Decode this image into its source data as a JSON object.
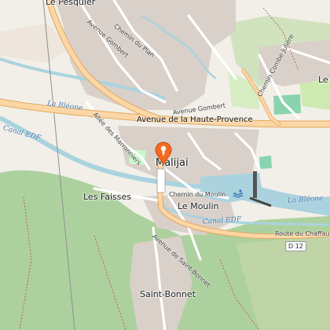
{
  "map": {
    "labels": {
      "le_peyquier": "Le Pesquier",
      "avenue_gombert_n": "Avenue Gombert",
      "chemin_du_plan": "Chemin du Plan",
      "avenue_gombert_s": "Avenue Gombert",
      "chemin_combe_juliere": "Chemin Combe Julière",
      "le_right": "Le",
      "la_bleone_w": "La Bléone",
      "allee_marronniers": "Allée des Marronniers",
      "avenue_haute_provence": "Avenue de la Haute-Provence",
      "canal_edf_w": "Canal EDF",
      "malijai": "Malijai",
      "les_faisses": "Les Faisses",
      "chemin_du_moulin": "Chemin du Moulin",
      "le_moulin": "Le Moulin",
      "la_bleone_e": "La Bléone",
      "canal_edf_e": "Canal EDF",
      "route_du_chaffaut": "Route du Chaffaut",
      "avenue_saint_bonnet": "Avenue de Saint-Bonnet",
      "saint_bonnet": "Saint-Bonnet"
    },
    "road_shields": {
      "d12": "D 12"
    },
    "marker_icon": "location-pin-icon",
    "water_sport_icon": "swimming-icon",
    "colors": {
      "background": "#f2efe9",
      "river": "#aad3df",
      "major_road": "#fcd6a4",
      "major_road_casing": "#e0a860",
      "minor_road": "#ffffff",
      "forest": "#add19e",
      "park": "#c8e8b8",
      "built": "#d9d0c9",
      "marker": "#f26b21"
    }
  }
}
